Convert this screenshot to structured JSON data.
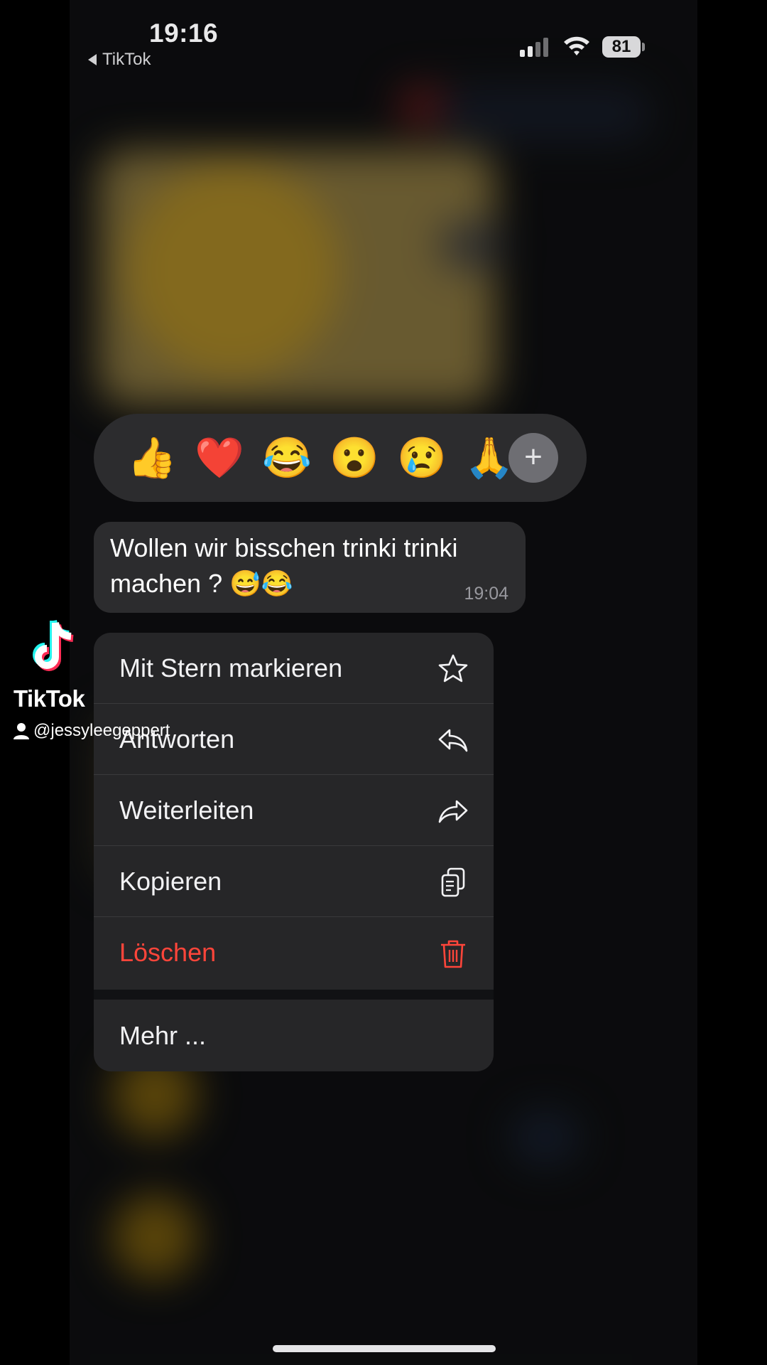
{
  "status_bar": {
    "time": "19:16",
    "back_label": "TikTok",
    "battery": "81"
  },
  "reactions": [
    "👍",
    "❤️",
    "😂",
    "😮",
    "😢",
    "🙏"
  ],
  "reaction_more": "+",
  "message": {
    "text": "Wollen wir bisschen trinki trinki machen ? 😅😂",
    "time": "19:04"
  },
  "menu": {
    "items": [
      {
        "label": "Mit Stern markieren",
        "icon": "star-icon"
      },
      {
        "label": "Antworten",
        "icon": "reply-icon"
      },
      {
        "label": "Weiterleiten",
        "icon": "forward-icon"
      },
      {
        "label": "Kopieren",
        "icon": "copy-icon"
      },
      {
        "label": "Löschen",
        "icon": "trash-icon",
        "color": "#ff453a"
      }
    ],
    "more_label": "Mehr ..."
  },
  "watermark": {
    "brand": "TikTok",
    "username": "@jessyleegeppert"
  },
  "colors": {
    "danger": "#ff453a",
    "bubble": "#2c2c2e",
    "menu": "#262628"
  }
}
